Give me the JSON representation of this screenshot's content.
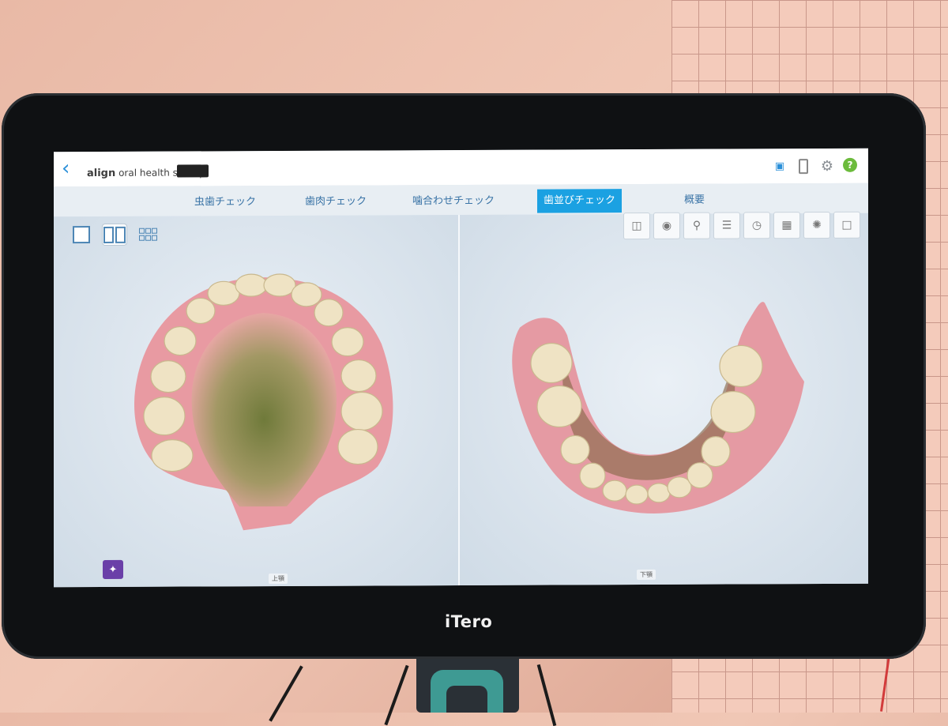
{
  "app": {
    "logo_brand": "align",
    "logo_product": "oral health suite",
    "device_brand": "iTero"
  },
  "icons": {
    "back": "chevron-left-icon",
    "camera": "camera-icon",
    "battery": "battery-icon",
    "settings": "gear-icon",
    "help": "help-icon",
    "lighting": "lightbulb-icon"
  },
  "tabs": [
    {
      "label": "虫歯チェック",
      "active": false
    },
    {
      "label": "歯肉チェック",
      "active": false
    },
    {
      "label": "噛合わせチェック",
      "active": false
    },
    {
      "label": "歯並びチェック",
      "active": true
    },
    {
      "label": "概要",
      "active": false
    }
  ],
  "view_modes": [
    "single-view",
    "dual-view",
    "multi-view"
  ],
  "active_view_mode": "dual-view",
  "tools": [
    "occlusion-tool-icon",
    "bite-tool-icon",
    "magnify-tool-icon",
    "gingiva-tool-icon",
    "clock-tool-icon",
    "grid-tool-icon",
    "loading-tool-icon",
    "clipboard-tool-icon"
  ],
  "panes": {
    "left_label": "上顎",
    "right_label": "下顎"
  },
  "help_glyph": "?",
  "colors": {
    "accent": "#1ba1e2",
    "help_green": "#6cbb3c",
    "lighting_purple": "#6a3fa8",
    "back_blue": "#2b90d9"
  }
}
